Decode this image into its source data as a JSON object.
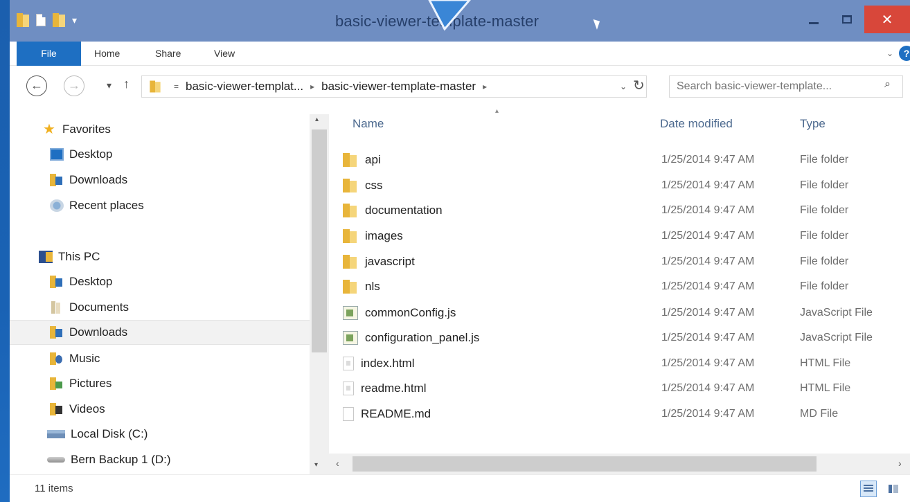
{
  "window": {
    "title": "basic-viewer-template-master",
    "close_glyph": "✕",
    "qat_arrow": "▾"
  },
  "ribbon": {
    "tabs": [
      {
        "label": "File"
      },
      {
        "label": "Home"
      },
      {
        "label": "Share"
      },
      {
        "label": "View"
      }
    ],
    "expand_glyph": "⌄",
    "help_glyph": "?"
  },
  "nav": {
    "back_glyph": "←",
    "forward_glyph": "→",
    "recent_glyph": "▾",
    "up_glyph": "↑",
    "breadcrumb": [
      "basic-viewer-templat...",
      "basic-viewer-template-master"
    ],
    "crumb_sep": "▸",
    "dropdown_glyph": "⌄",
    "refresh_glyph": "↻",
    "search_placeholder": "Search basic-viewer-template...",
    "search_glyph": "⌕"
  },
  "navpane": {
    "items": [
      {
        "label": "Favorites"
      },
      {
        "label": "Desktop"
      },
      {
        "label": "Downloads"
      },
      {
        "label": "Recent places"
      },
      {
        "label": "This PC"
      },
      {
        "label": "Desktop"
      },
      {
        "label": "Documents"
      },
      {
        "label": "Downloads"
      },
      {
        "label": "Music"
      },
      {
        "label": "Pictures"
      },
      {
        "label": "Videos"
      },
      {
        "label": "Local Disk (C:)"
      },
      {
        "label": "Bern Backup 1 (D:)"
      }
    ],
    "scroll_up": "▴",
    "scroll_down": "▾"
  },
  "filelist": {
    "columns": {
      "name": "Name",
      "date": "Date modified",
      "type": "Type"
    },
    "sort_glyph": "▴",
    "rows": [
      {
        "name": "api",
        "date": "1/25/2014 9:47 AM",
        "type": "File folder"
      },
      {
        "name": "css",
        "date": "1/25/2014 9:47 AM",
        "type": "File folder"
      },
      {
        "name": "documentation",
        "date": "1/25/2014 9:47 AM",
        "type": "File folder"
      },
      {
        "name": "images",
        "date": "1/25/2014 9:47 AM",
        "type": "File folder"
      },
      {
        "name": "javascript",
        "date": "1/25/2014 9:47 AM",
        "type": "File folder"
      },
      {
        "name": "nls",
        "date": "1/25/2014 9:47 AM",
        "type": "File folder"
      },
      {
        "name": "commonConfig.js",
        "date": "1/25/2014 9:47 AM",
        "type": "JavaScript File"
      },
      {
        "name": "configuration_panel.js",
        "date": "1/25/2014 9:47 AM",
        "type": "JavaScript File"
      },
      {
        "name": "index.html",
        "date": "1/25/2014 9:47 AM",
        "type": "HTML File"
      },
      {
        "name": "readme.html",
        "date": "1/25/2014 9:47 AM",
        "type": "HTML File"
      },
      {
        "name": "README.md",
        "date": "1/25/2014 9:47 AM",
        "type": "MD File"
      }
    ],
    "scroll_left": "‹",
    "scroll_right": "›"
  },
  "status": {
    "items_count": "11 items"
  },
  "colors": {
    "titlebar": "#6f8ec2",
    "file_tab": "#1e6fc2",
    "close_button": "#d8473a",
    "desktop_bg": "#1b5fae"
  }
}
